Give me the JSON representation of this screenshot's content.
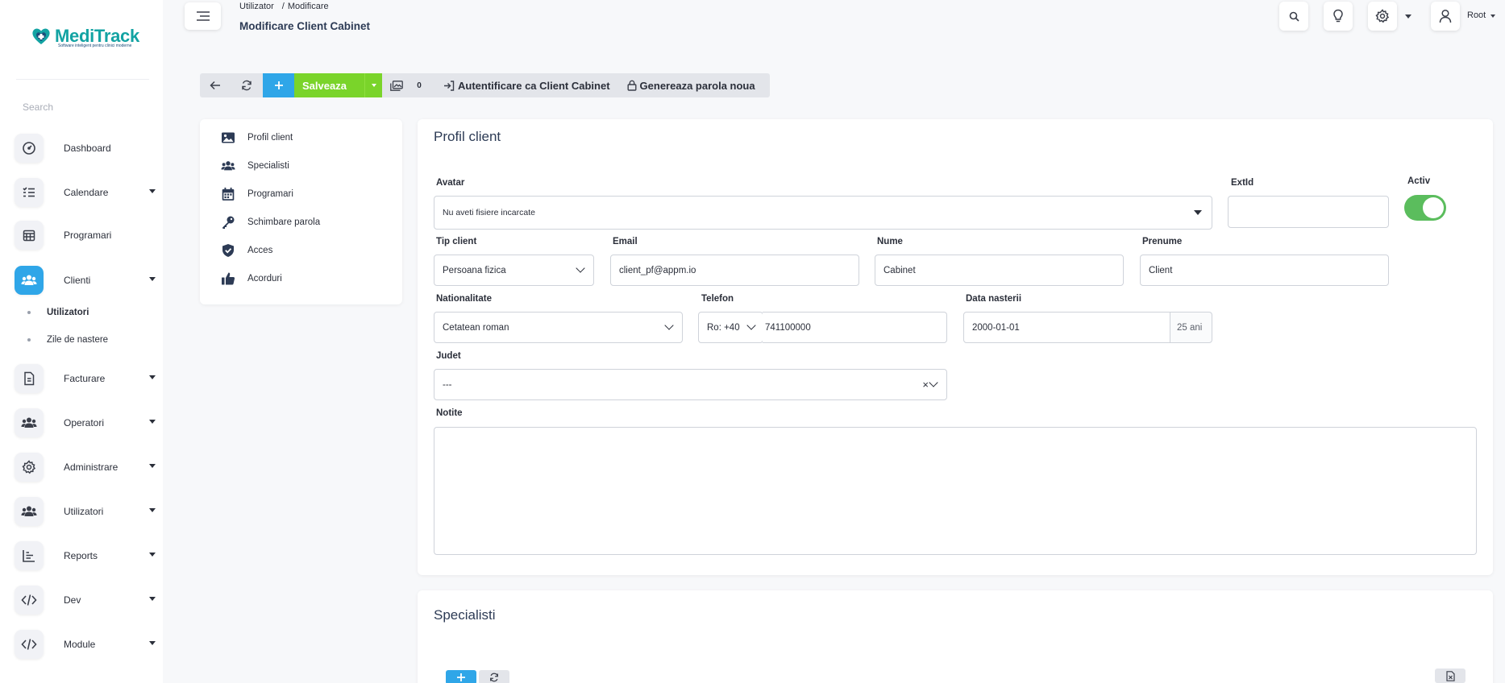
{
  "app": {
    "name": "MediTrack",
    "tagline": "Software inteligent pentru clinici moderne",
    "colors": {
      "brand": "#13a3a3",
      "primary": "#2fa6e8",
      "success": "#7ad42a",
      "toggle_on": "#5bbd5d"
    }
  },
  "sidebar": {
    "search_placeholder": "Search",
    "items": [
      {
        "label": "Dashboard",
        "icon": "dashboard-gauge-icon"
      },
      {
        "label": "Calendare",
        "icon": "list-check-icon"
      },
      {
        "label": "Programari",
        "icon": "calendar-grid-icon"
      },
      {
        "label": "Clienti",
        "icon": "users-icon",
        "active": true
      },
      {
        "label": "Facturare",
        "icon": "document-icon"
      },
      {
        "label": "Operatori",
        "icon": "users-icon"
      },
      {
        "label": "Administrare",
        "icon": "gear-icon"
      },
      {
        "label": "Utilizatori",
        "icon": "users-icon"
      },
      {
        "label": "Reports",
        "icon": "bar-chart-icon"
      },
      {
        "label": "Dev",
        "icon": "code-icon"
      },
      {
        "label": "Module",
        "icon": "code-icon"
      }
    ],
    "clienti_subitems": [
      {
        "label": "Utilizatori",
        "active": true
      },
      {
        "label": "Zile de nastere"
      }
    ]
  },
  "header": {
    "breadcrumb": [
      "Utilizator",
      "/",
      "Modificare"
    ],
    "title": "Modificare Client Cabinet",
    "user_label": "Root"
  },
  "toolbar": {
    "save_label": "Salveaza",
    "images_count": "0",
    "login_as_label": "Autentificare ca Client Cabinet",
    "generate_password_label": "Genereaza parola noua"
  },
  "sections_nav": [
    {
      "label": "Profil client",
      "icon": "image-icon"
    },
    {
      "label": "Specialisti",
      "icon": "users-icon"
    },
    {
      "label": "Programari",
      "icon": "calendar-icon"
    },
    {
      "label": "Schimbare parola",
      "icon": "key-icon"
    },
    {
      "label": "Acces",
      "icon": "shield-check-icon"
    },
    {
      "label": "Acorduri",
      "icon": "thumbs-up-icon"
    }
  ],
  "profile": {
    "title": "Profil client",
    "avatar": {
      "label": "Avatar",
      "value": "Nu aveti fisiere incarcate"
    },
    "extid": {
      "label": "ExtId",
      "value": ""
    },
    "activ": {
      "label": "Activ",
      "value": true
    },
    "tip_client": {
      "label": "Tip client",
      "value": "Persoana fizica"
    },
    "email": {
      "label": "Email",
      "value": "client_pf@appm.io"
    },
    "nume": {
      "label": "Nume",
      "value": "Cabinet"
    },
    "prenume": {
      "label": "Prenume",
      "value": "Client"
    },
    "nationalitate": {
      "label": "Nationalitate",
      "value": "Cetatean roman"
    },
    "telefon": {
      "label": "Telefon",
      "prefix": "Ro: +40",
      "value": "741100000"
    },
    "data_nasterii": {
      "label": "Data nasterii",
      "value": "2000-01-01",
      "age": "25 ani"
    },
    "judet": {
      "label": "Judet",
      "value": "---",
      "clear": "×"
    },
    "notite": {
      "label": "Notite",
      "value": ""
    }
  },
  "specialisti": {
    "title": "Specialisti"
  }
}
